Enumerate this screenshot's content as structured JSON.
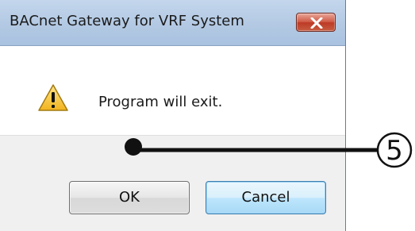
{
  "dialog": {
    "title": "BACnet Gateway for VRF System",
    "message": "Program will exit.",
    "ok_label": "OK",
    "cancel_label": "Cancel",
    "icons": {
      "close": "close-icon",
      "warning": "warning-icon"
    }
  },
  "annotation": {
    "callout_number": "5"
  },
  "colors": {
    "title_bar": "#b3c9e3",
    "close_button": "#c94b35",
    "warning_triangle": "#f6c531",
    "default_button_border": "#3c7fb1"
  }
}
